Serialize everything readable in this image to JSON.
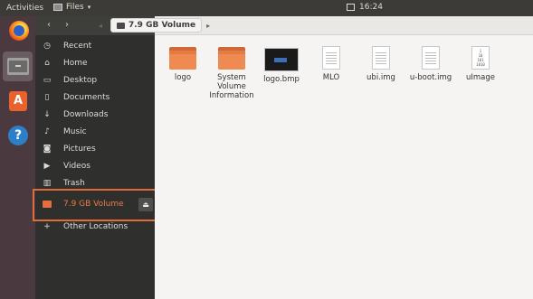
{
  "topbar": {
    "activities": "Activities",
    "app_name": "Files",
    "time": "16:24"
  },
  "launcher": {
    "items": [
      "firefox-icon",
      "files-icon",
      "software-center-icon",
      "help-icon"
    ]
  },
  "header": {
    "location": "7.9 GB Volume"
  },
  "sidebar": {
    "items": [
      {
        "label": "Recent",
        "icon": "clock-icon"
      },
      {
        "label": "Home",
        "icon": "home-icon"
      },
      {
        "label": "Desktop",
        "icon": "desktop-icon"
      },
      {
        "label": "Documents",
        "icon": "document-icon"
      },
      {
        "label": "Downloads",
        "icon": "download-icon"
      },
      {
        "label": "Music",
        "icon": "music-icon"
      },
      {
        "label": "Pictures",
        "icon": "camera-icon"
      },
      {
        "label": "Videos",
        "icon": "video-icon"
      },
      {
        "label": "Trash",
        "icon": "trash-icon"
      },
      {
        "label": "7.9 GB Volume",
        "icon": "drive-icon",
        "selected": true
      },
      {
        "label": "Other Locations",
        "icon": "plus-icon"
      }
    ]
  },
  "files": [
    {
      "name": "logo",
      "type": "folder"
    },
    {
      "name": "System Volume Information",
      "type": "folder"
    },
    {
      "name": "logo.bmp",
      "type": "image"
    },
    {
      "name": "MLO",
      "type": "file"
    },
    {
      "name": "ubi.img",
      "type": "file"
    },
    {
      "name": "u-boot.img",
      "type": "file"
    },
    {
      "name": "uImage",
      "type": "binary"
    }
  ],
  "colors": {
    "accent": "#e06c3a",
    "sidebar_bg": "#2f302d",
    "launcher_bg": "#4a3a3f"
  }
}
